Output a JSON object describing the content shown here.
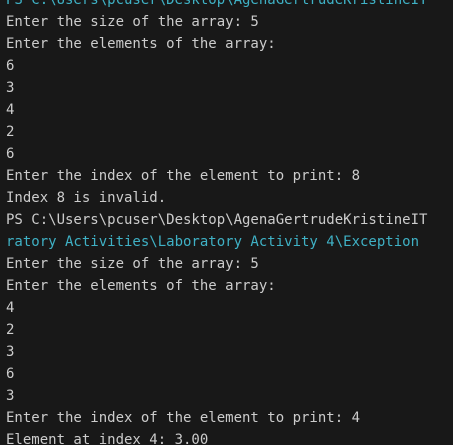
{
  "terminal": {
    "lines": [
      {
        "text": "PS C:\\Users\\pcuser\\Desktop\\AgenaGertrudeKristineIT",
        "kind": "path"
      },
      {
        "text": "Enter the size of the array: 5",
        "kind": "output"
      },
      {
        "text": "Enter the elements of the array:",
        "kind": "output"
      },
      {
        "text": "6",
        "kind": "output"
      },
      {
        "text": "3",
        "kind": "output"
      },
      {
        "text": "4",
        "kind": "output"
      },
      {
        "text": "2",
        "kind": "output"
      },
      {
        "text": "6",
        "kind": "output"
      },
      {
        "text": "Enter the index of the element to print: 8",
        "kind": "output"
      },
      {
        "text": "Index 8 is invalid.",
        "kind": "output"
      },
      {
        "text": "PS C:\\Users\\pcuser\\Desktop\\AgenaGertrudeKristineIT",
        "kind": "prompt"
      },
      {
        "text": "ratory Activities\\Laboratory Activity 4\\Exception",
        "kind": "path"
      },
      {
        "text": "Enter the size of the array: 5",
        "kind": "output"
      },
      {
        "text": "Enter the elements of the array:",
        "kind": "output"
      },
      {
        "text": "4",
        "kind": "output"
      },
      {
        "text": "2",
        "kind": "output"
      },
      {
        "text": "3",
        "kind": "output"
      },
      {
        "text": "6",
        "kind": "output"
      },
      {
        "text": "3",
        "kind": "output"
      },
      {
        "text": "Enter the index of the element to print: 4",
        "kind": "output"
      },
      {
        "text": "Element at index 4: 3.00",
        "kind": "output"
      }
    ]
  },
  "colors": {
    "background": "#181818",
    "foreground": "#cccccc",
    "path": "#3fb1c5"
  }
}
